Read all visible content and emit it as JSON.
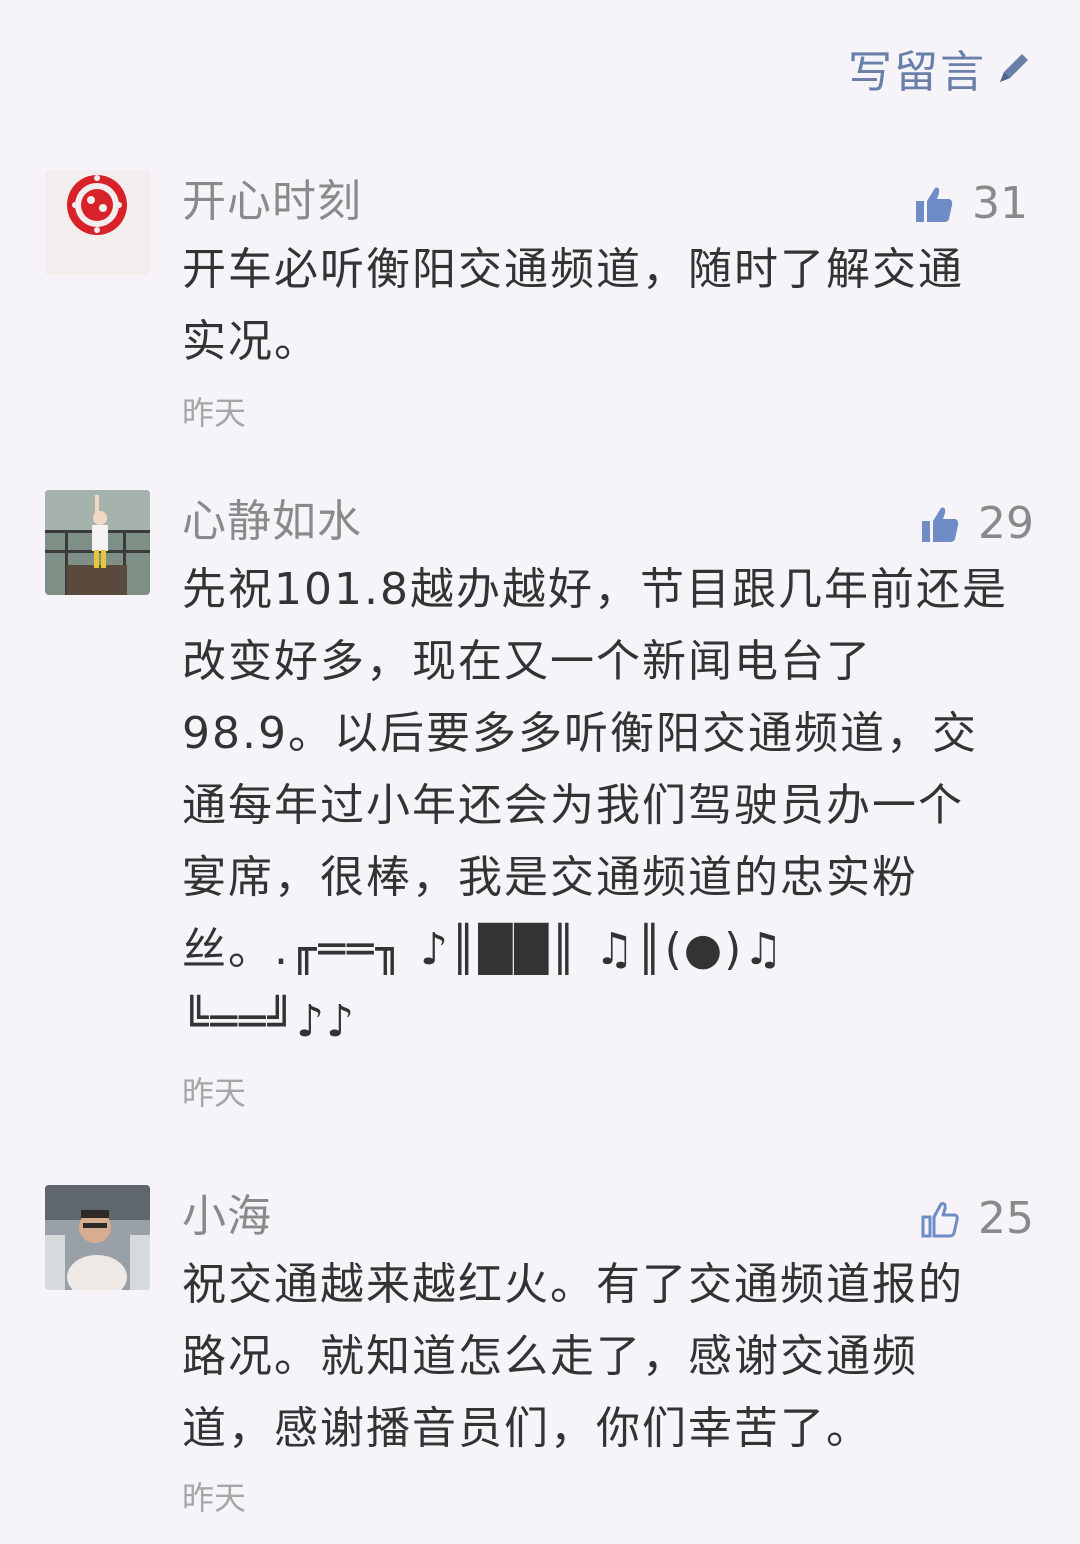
{
  "header": {
    "write_label": "写留言"
  },
  "comments": [
    {
      "nickname": "开心时刻",
      "likes": "31",
      "content": "开车必听衡阳交通频道，随时了解交通\n实况。",
      "time": "昨天"
    },
    {
      "nickname": "心静如水",
      "likes": "29",
      "content": "先祝101.8越办越好，节目跟几年前还是\n改变好多，现在又一个新闻电台了\n98.9。以后要多多听衡阳交通频道，交\n通每年过小年还会为我们驾驶员办一个\n宴席，很棒，我是交通频道的忠实粉\n丝。.╓══╖ ♪║██║ ♫║(●)♫\n╚══╝♪♪",
      "time": "昨天"
    },
    {
      "nickname": "小海",
      "likes": "25",
      "content": "祝交通越来越红火。有了交通频道报的\n路况。就知道怎么走了，感谢交通频\n道，感谢播音员们，你们幸苦了。",
      "time": "昨天"
    }
  ],
  "colors": {
    "background": "#f6f4f8",
    "link": "#6a7faa",
    "like_icon": "#6f8cc6",
    "text": "#333333",
    "meta": "#8a8a8a"
  }
}
